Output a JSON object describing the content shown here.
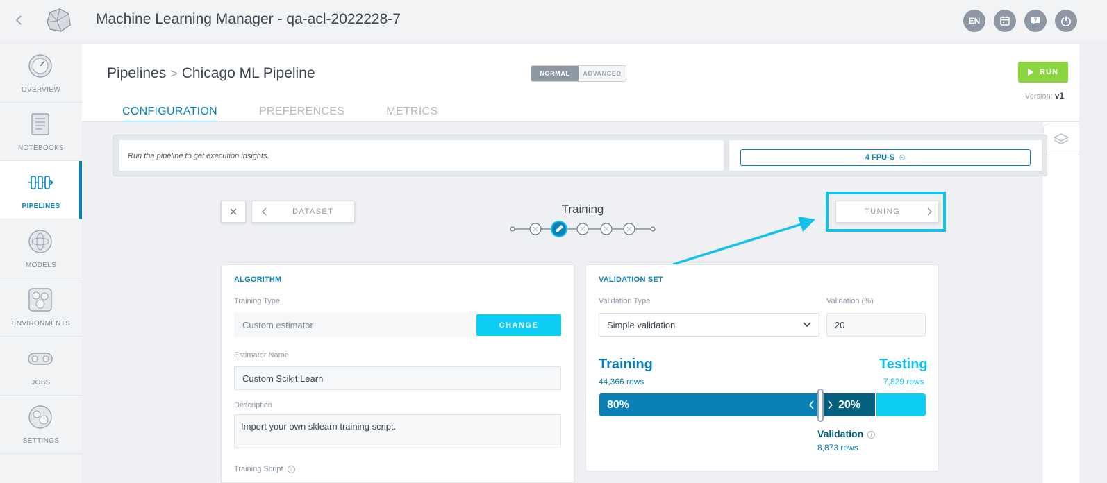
{
  "app": {
    "title": "Machine Learning Manager - qa-acl-2022228-7"
  },
  "topbar": {
    "lang_label": "EN",
    "icons": [
      "calendar-icon",
      "help-icon",
      "power-icon"
    ]
  },
  "sidebar": {
    "items": [
      {
        "label": "OVERVIEW",
        "icon": "gauge-icon",
        "active": false
      },
      {
        "label": "NOTEBOOKS",
        "icon": "notebook-icon",
        "active": false
      },
      {
        "label": "PIPELINES",
        "icon": "pipeline-icon",
        "active": true
      },
      {
        "label": "MODELS",
        "icon": "models-icon",
        "active": false
      },
      {
        "label": "ENVIRONMENTS",
        "icon": "environments-icon",
        "active": false
      },
      {
        "label": "JOBS",
        "icon": "jobs-icon",
        "active": false
      },
      {
        "label": "SETTINGS",
        "icon": "settings-icon",
        "active": false
      }
    ]
  },
  "breadcrumb": {
    "root": "Pipelines",
    "sep": ">",
    "current": "Chicago ML Pipeline"
  },
  "mode": {
    "normal": "NORMAL",
    "advanced": "ADVANCED",
    "selected": "NORMAL"
  },
  "run": {
    "label": "RUN"
  },
  "version": {
    "label": "Version:",
    "value": "v1"
  },
  "tabs": [
    {
      "label": "CONFIGURATION",
      "active": true
    },
    {
      "label": "PREFERENCES",
      "active": false
    },
    {
      "label": "METRICS",
      "active": false
    }
  ],
  "insights": {
    "text": "Run the pipeline to get execution insights."
  },
  "fpu": {
    "label": "4 FPU-S"
  },
  "steps": {
    "prev_label": "DATASET",
    "current_title": "Training",
    "next_label": "TUNING",
    "count": 6,
    "current_index": 2
  },
  "algorithm": {
    "title": "ALGORITHM",
    "training_type_label": "Training Type",
    "training_type_value": "Custom estimator",
    "change_label": "CHANGE",
    "estimator_name_label": "Estimator Name",
    "estimator_name_value": "Custom Scikit Learn",
    "description_label": "Description",
    "description_value": "Import your own sklearn training script.",
    "training_script_label": "Training Script"
  },
  "validation": {
    "title": "VALIDATION SET",
    "type_label": "Validation Type",
    "type_value": "Simple validation",
    "percent_label": "Validation (%)",
    "percent_value": "20",
    "training_label": "Training",
    "training_rows": "44,366 rows",
    "testing_label": "Testing",
    "testing_rows": "7,829 rows",
    "train_pct": "80%",
    "val_pct": "20%",
    "validation_label": "Validation",
    "validation_rows": "8,873 rows"
  },
  "colors": {
    "accent": "#0a82b6",
    "highlight": "#13c2ec",
    "run": "#8ad43f",
    "testing": "#0ecdf5"
  }
}
